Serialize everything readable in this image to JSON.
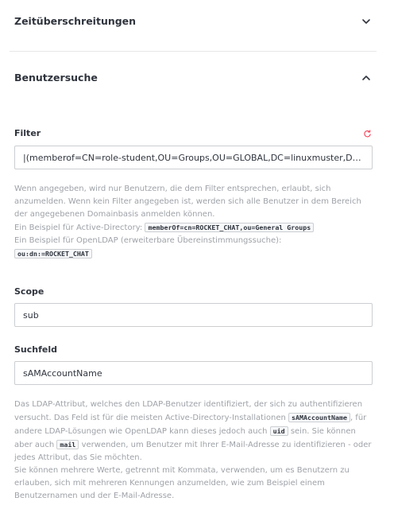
{
  "sections": [
    {
      "title": "Zeitüberschreitungen",
      "expanded": false
    },
    {
      "title": "Benutzersuche",
      "expanded": true
    }
  ],
  "filter": {
    "label": "Filter",
    "value": "|(memberof=CN=role-student,OU=Groups,OU=GLOBAL,DC=linuxmuster,DC=lan)( ...",
    "hint_line1": "Wenn angegeben, wird nur Benutzern, die dem Filter entsprechen, erlaubt, sich",
    "hint_line2": "anzumelden. Wenn kein Filter angegeben ist, werden sich alle Benutzer in dem Bereich",
    "hint_line3": "der angegebenen Domainbasis anmelden können.",
    "hint_ad_prefix": "Ein Beispiel für Active-Directory:",
    "hint_ad_code": "memberOf=cn=ROCKET_CHAT,ou=General Groups",
    "hint_ldap_prefix": "Ein Beispiel für OpenLDAP (erweiterbare Übereinstimmungssuche):",
    "hint_ldap_code": "ou:dn:=ROCKET_CHAT"
  },
  "scope": {
    "label": "Scope",
    "value": "sub"
  },
  "suchfeld": {
    "label": "Suchfeld",
    "value": "sAMAccountName",
    "hint_p1": "Das LDAP-Attribut, welches den LDAP-Benutzer identifiziert, der sich zu authentifizieren versucht. Das Feld ist für die meisten Active-Directory-Installationen",
    "hint_code1": "sAMAccountName",
    "hint_p2": ", für andere LDAP-Lösungen wie OpenLDAP kann dieses jedoch auch",
    "hint_code2": "uid",
    "hint_p3": " sein. Sie können aber auch",
    "hint_code3": "mail",
    "hint_p4": " verwenden, um Benutzer mit Ihrer E-Mail-Adresse zu identifizieren - oder jedes Attribut, das Sie möchten.",
    "hint_p5": "Sie können mehrere Werte, getrennt mit Kommata, verwenden, um es Benutzern zu erlauben, sich mit mehreren Kennungen anzumelden, wie zum Beispiel einem Benutzernamen und der E-Mail-Adresse."
  },
  "icons": {
    "collapsed": "chevron-down-icon",
    "expanded": "chevron-up-icon",
    "reset": "reset-icon"
  },
  "colors": {
    "text": "#2f343d",
    "hint": "#9ea2a8",
    "border": "#cbced1",
    "reset": "#f5455c"
  }
}
